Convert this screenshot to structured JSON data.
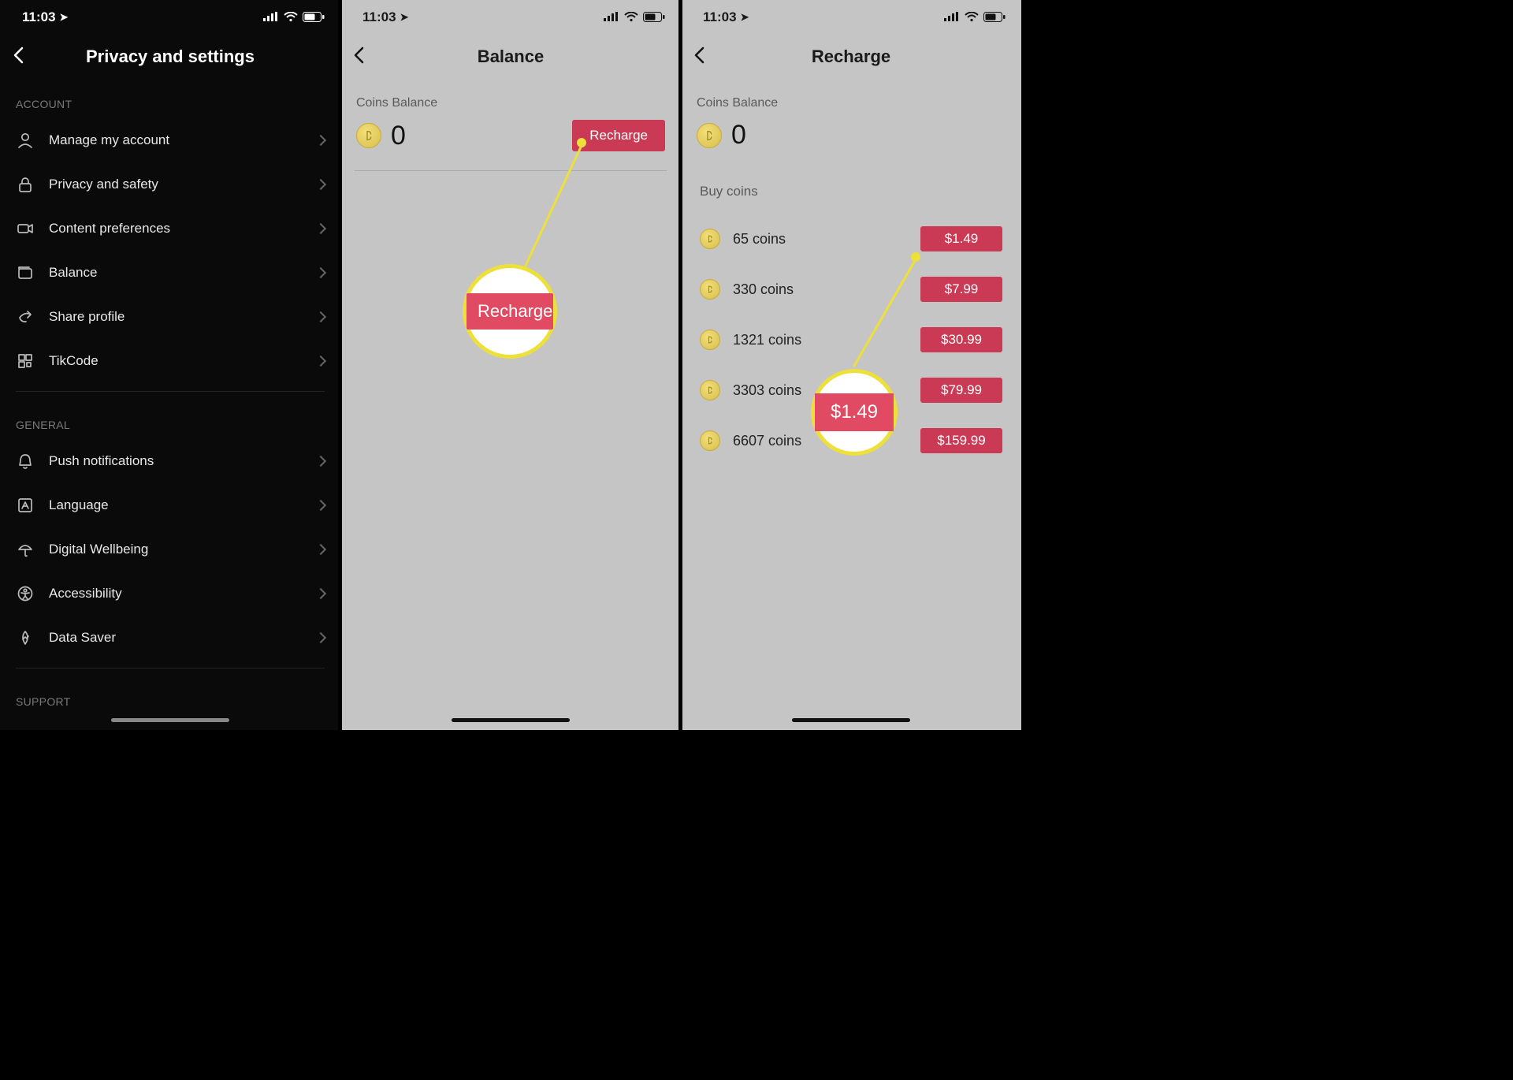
{
  "status": {
    "time": "11:03"
  },
  "screen1": {
    "title": "Privacy and settings",
    "sections": {
      "account_label": "ACCOUNT",
      "account_items": [
        "Manage my account",
        "Privacy and safety",
        "Content preferences",
        "Balance",
        "Share profile",
        "TikCode"
      ],
      "general_label": "GENERAL",
      "general_items": [
        "Push notifications",
        "Language",
        "Digital Wellbeing",
        "Accessibility",
        "Data Saver"
      ],
      "support_label": "SUPPORT"
    }
  },
  "screen2": {
    "title": "Balance",
    "coins_label": "Coins Balance",
    "coins_value": "0",
    "recharge_label": "Recharge",
    "callout_label": "Recharge"
  },
  "screen3": {
    "title": "Recharge",
    "coins_label": "Coins Balance",
    "coins_value": "0",
    "buy_label": "Buy coins",
    "packages": [
      {
        "label": "65 coins",
        "price": "$1.49"
      },
      {
        "label": "330 coins",
        "price": "$7.99"
      },
      {
        "label": "1321 coins",
        "price": "$30.99"
      },
      {
        "label": "3303 coins",
        "price": "$79.99"
      },
      {
        "label": "6607 coins",
        "price": "$159.99"
      }
    ],
    "callout_label": "$1.49"
  }
}
